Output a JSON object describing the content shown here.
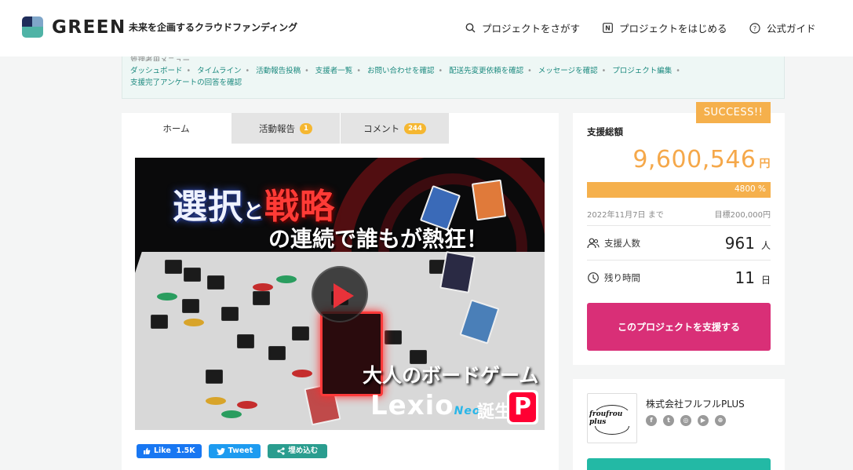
{
  "header": {
    "brand": "GREEN",
    "tagline": "未来を企画するクラウドファンディング",
    "nav": {
      "search": "プロジェクトをさがす",
      "start": "プロジェクトをはじめる",
      "guide": "公式ガイド"
    }
  },
  "owner_menu": {
    "title": "管理者用メニュー",
    "links": [
      "ダッシュボード",
      "タイムライン",
      "活動報告投稿",
      "支援者一覧",
      "お問い合わせを確認",
      "配送先変更依頼を確認",
      "メッセージを確認",
      "プロジェクト編集",
      "支援完了アンケートの回答を確認"
    ]
  },
  "tabs": [
    {
      "label": "ホーム",
      "badge": null
    },
    {
      "label": "活動報告",
      "badge": "1"
    },
    {
      "label": "コメント",
      "badge": "244"
    }
  ],
  "hero": {
    "line1_a": "選択",
    "line1_to": "と",
    "line1_b": "戦略",
    "line2": "の連続で誰もが熱狂！",
    "line3": "大人のボードゲーム",
    "logo_word": "Lexio",
    "logo_neo": "Neo",
    "line4_tail": "誕生",
    "paypay_mark": "P"
  },
  "share": {
    "like_label": "Like",
    "like_count": "1.5K",
    "tweet_label": "Tweet",
    "embed_label": "埋め込む"
  },
  "stats": {
    "status": "SUCCESS!!",
    "total_label": "支援総額",
    "total_amount": "9,600,546",
    "currency": "円",
    "progress_percent": 4800,
    "progress_text": "4800 %",
    "deadline": "2022年11月7日 まで",
    "goal": "目標200,000円",
    "backers_label": "支援人数",
    "backers_value": "961",
    "backers_unit": "人",
    "remaining_label": "残り時間",
    "remaining_value": "11",
    "remaining_unit": "日",
    "support_button": "このプロジェクトを支援する"
  },
  "owner": {
    "logo_text": "froufrou plus",
    "name": "株式会社フルフルPLUS",
    "social_icons": [
      "facebook-icon",
      "twitter-icon",
      "instagram-icon",
      "youtube-icon",
      "globe-icon"
    ]
  },
  "colors": {
    "accent_orange": "#f5b04c",
    "support_pink": "#d92f77",
    "green": "#23b9a5"
  }
}
